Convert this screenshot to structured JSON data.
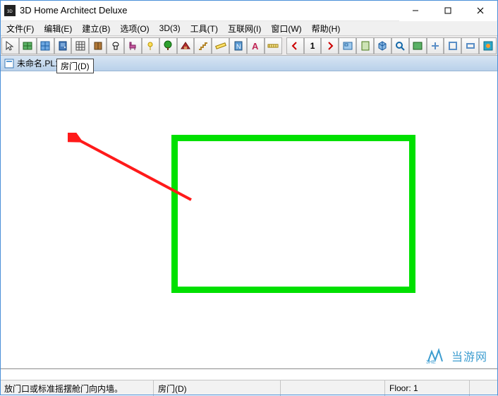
{
  "app": {
    "title": "3D Home Architect Deluxe"
  },
  "menus": [
    "文件(F)",
    "编辑(E)",
    "建立(B)",
    "选项(O)",
    "3D(3)",
    "工具(T)",
    "互联网(I)",
    "窗口(W)",
    "帮助(H)"
  ],
  "toolbar_icons": [
    "pointer-icon",
    "wall-icon",
    "window-icon",
    "door-icon",
    "grid-icon",
    "cabinet-icon",
    "toilet-icon",
    "chair-icon",
    "lamp-icon",
    "tree-icon",
    "roof-icon",
    "stairs-icon",
    "ruler-icon",
    "note-icon",
    "text-icon",
    "dimension-icon",
    "prev-icon",
    "page-1-icon",
    "next-icon",
    "plan-icon",
    "elevation-icon",
    "3d-icon",
    "zoom-icon",
    "alt-tool-1",
    "alt-tool-2",
    "alt-tool-3",
    "alt-tool-4",
    "fire-icon"
  ],
  "document": {
    "label": "未命名.PL1: Plan"
  },
  "tooltip": {
    "text": "房门(D)"
  },
  "status": {
    "hint": "放门口或标准摇摆舱门向内墙。",
    "tool": "房门(D)",
    "floor": "Floor: 1"
  },
  "watermark": {
    "text": "当游网"
  },
  "nav": {
    "page": "1"
  }
}
